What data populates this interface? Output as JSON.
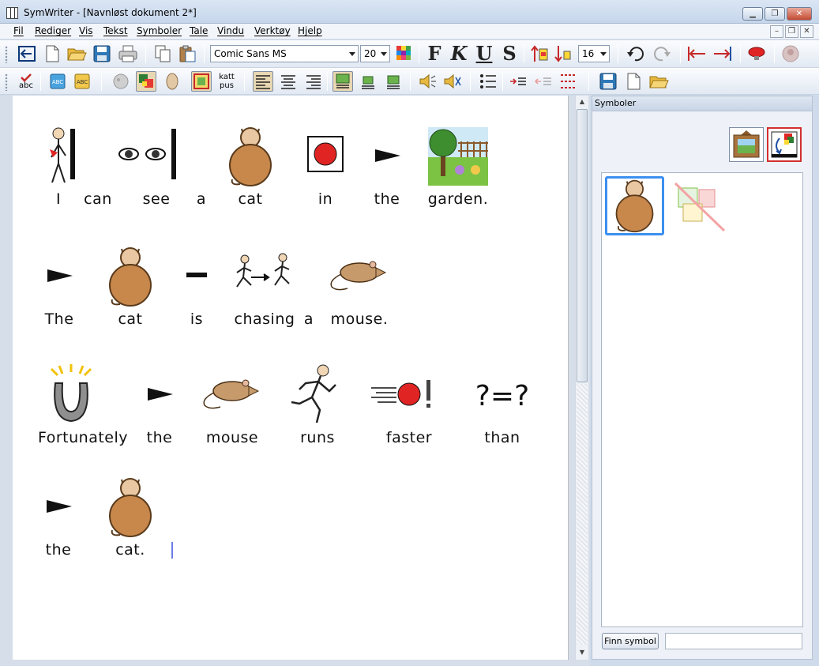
{
  "window": {
    "title": "SymWriter - [Navnløst dokument 2*]"
  },
  "menu": [
    "Fil",
    "Rediger",
    "Vis",
    "Tekst",
    "Symboler",
    "Tale",
    "Vindu",
    "Verktøy",
    "Hjelp"
  ],
  "toolbar": {
    "font_name": "Comic Sans MS",
    "font_size": "20",
    "symbol_size": "16",
    "bold_label": "F",
    "italic_label": "K",
    "underline_label": "U",
    "strike_label": "S",
    "word_sym_label_top": "katt",
    "word_sym_label_bottom": "pus",
    "spell_label": "abc",
    "abc_label": "ABC"
  },
  "document": {
    "lines": [
      {
        "words": [
          {
            "text": "I",
            "symbol": "person-me-icon"
          },
          {
            "text": "can",
            "symbol": "can-see-eyes-icon"
          },
          {
            "text": "see",
            "symbol": "eyes-icon"
          },
          {
            "text": "a",
            "symbol": ""
          },
          {
            "text": "cat",
            "symbol": "cat-icon"
          },
          {
            "text": "in",
            "symbol": "in-icon"
          },
          {
            "text": "the",
            "symbol": "the-arrow-icon"
          },
          {
            "text": "garden.",
            "symbol": "garden-icon"
          }
        ]
      },
      {
        "words": [
          {
            "text": "The",
            "symbol": "the-arrow-icon"
          },
          {
            "text": "cat",
            "symbol": "cat-icon"
          },
          {
            "text": "is",
            "symbol": "is-dash-icon"
          },
          {
            "text": "chasing",
            "symbol": "chasing-icon"
          },
          {
            "text": "a",
            "symbol": ""
          },
          {
            "text": "mouse.",
            "symbol": "mouse-icon"
          }
        ]
      },
      {
        "words": [
          {
            "text": "Fortunately",
            "symbol": "horseshoe-icon"
          },
          {
            "text": "the",
            "symbol": "the-arrow-icon"
          },
          {
            "text": "mouse",
            "symbol": "mouse-icon"
          },
          {
            "text": "runs",
            "symbol": "runner-icon"
          },
          {
            "text": "faster",
            "symbol": "faster-icon"
          },
          {
            "text": "than",
            "symbol": "than-icon"
          }
        ]
      },
      {
        "words": [
          {
            "text": "the",
            "symbol": "the-arrow-icon"
          },
          {
            "text": "cat.",
            "symbol": "cat-icon"
          }
        ]
      }
    ]
  },
  "symbol_panel": {
    "title": "Symboler",
    "find_button": "Finn symbol",
    "find_value": ""
  },
  "colors": {
    "selection": "#3c8ff0",
    "caret": "#6c7de8",
    "cat_body": "#c8884c"
  }
}
